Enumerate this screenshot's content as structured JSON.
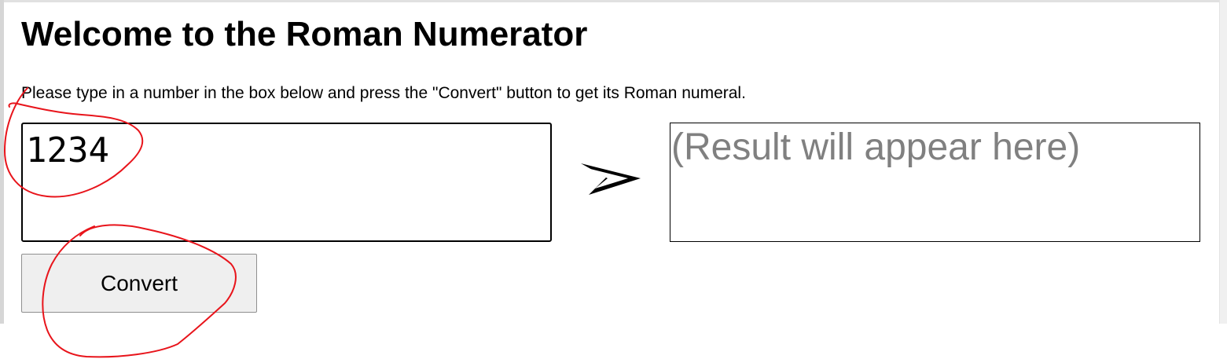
{
  "page": {
    "title": "Welcome to the Roman Numerator",
    "instructions": "Please type in a number in the box below and press the \"Convert\" button to get its Roman numeral."
  },
  "input": {
    "value": "1234"
  },
  "result": {
    "placeholder": "(Result will appear here)"
  },
  "button": {
    "label": "Convert"
  },
  "icons": {
    "arrow": "arrow-right-icon"
  },
  "colors": {
    "annotation": "#e8141b",
    "placeholder_text": "#808080",
    "button_background": "#efefef"
  }
}
